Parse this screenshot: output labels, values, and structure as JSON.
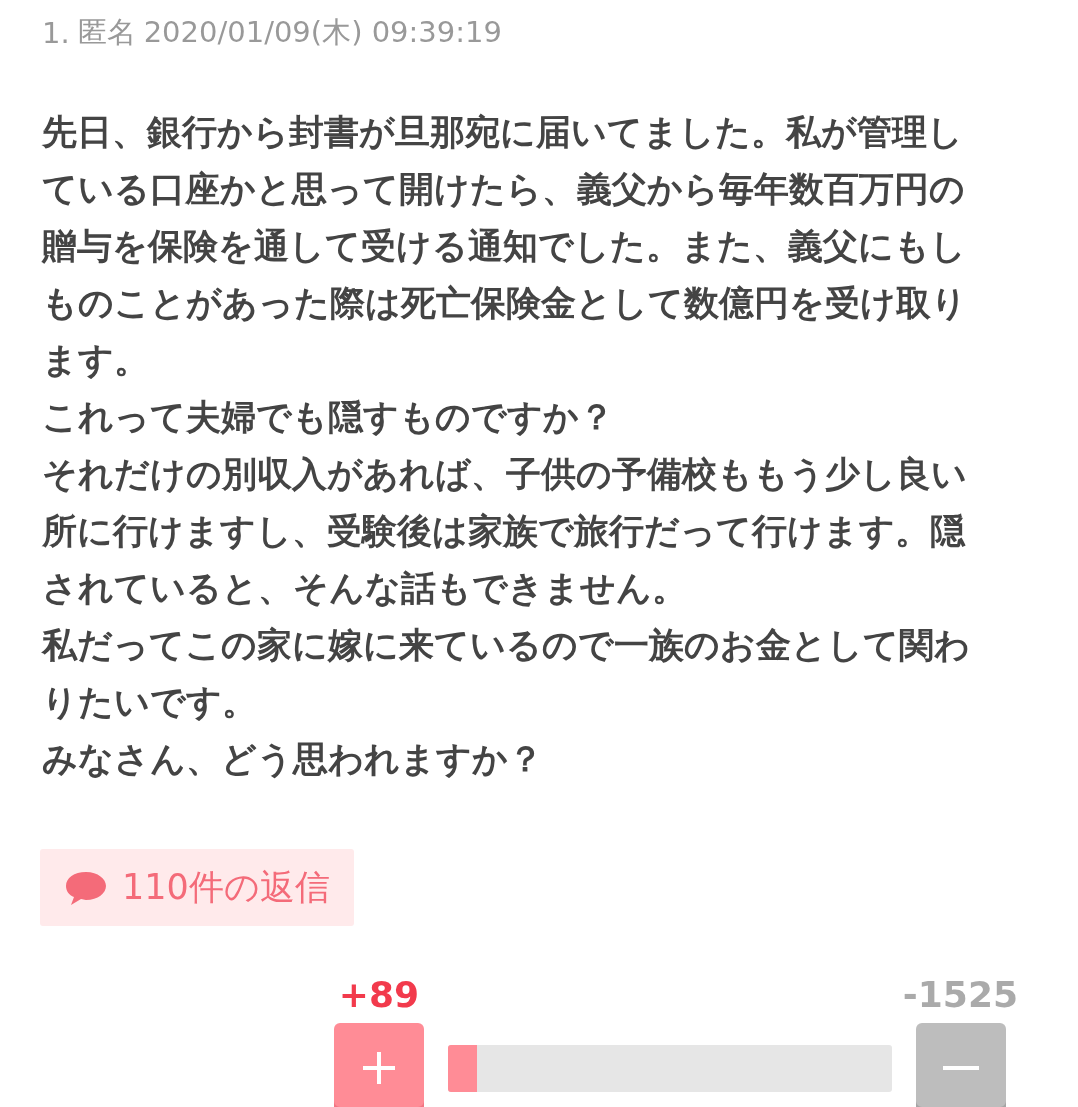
{
  "post": {
    "number": "1.",
    "author": "匿名",
    "date": "2020/01/09(木) 09:39:19",
    "lines": [
      "先日、銀行から封書が旦那宛に届いてました。私が管理している口座かと思って開けたら、義父から毎年数百万円の贈与を保険を通して受ける通知でした。また、義父にもしものことがあった際は死亡保険金として数億円を受け取ります。",
      "これって夫婦でも隠すものですか？",
      "それだけの別収入があれば、子供の予備校ももう少し良い所に行けますし、受験後は家族で旅行だって行けます。隠されていると、そんな話もできません。",
      "私だってこの家に嫁に来ているので一族のお金として関わりたいです。",
      "みなさん、どう思われますか？"
    ],
    "replies": "110件の返信",
    "votes": {
      "plus": "+89",
      "minus": "-1525",
      "level": 0.065
    }
  }
}
